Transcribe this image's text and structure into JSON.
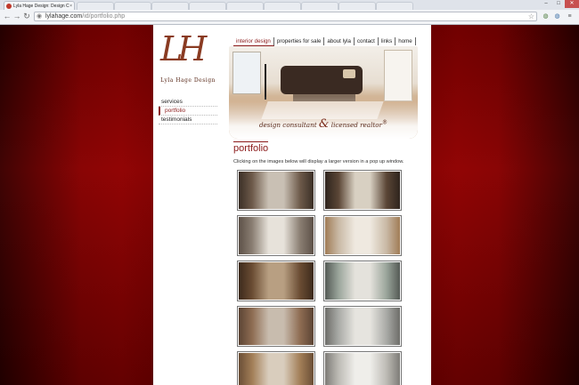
{
  "browser": {
    "tab_title": "Lyla Hage Design: Design C",
    "close_glyph": "×",
    "url_host": "lylahage.com",
    "url_path": "/id/portfolio.php",
    "nav_icons": [
      "back-arrow-icon",
      "forward-arrow-icon",
      "reload-icon"
    ],
    "window_controls": [
      "minimize-icon",
      "maximize-icon",
      "close-icon"
    ]
  },
  "site": {
    "logo_monogram": "LH",
    "logo_name": "Lyla Hage Design",
    "top_nav": [
      {
        "label": "interior design",
        "active": true
      },
      {
        "label": "properties for sale",
        "active": false
      },
      {
        "label": "about lyla",
        "active": false
      },
      {
        "label": "contact",
        "active": false
      },
      {
        "label": "links",
        "active": false
      },
      {
        "label": "home",
        "active": false
      }
    ],
    "side_nav": [
      {
        "label": "services",
        "active": false
      },
      {
        "label": "portfolio",
        "active": true
      },
      {
        "label": "testimonials",
        "active": false
      }
    ],
    "tagline_left": "design consultant",
    "tagline_amp": "&",
    "tagline_right": "licensed realtor",
    "tagline_mark": "®",
    "section_title": "portfolio",
    "intro_text": "Clicking on the images below will display a larger version in a pop up window.",
    "thumbnails": [
      {
        "name": "thumb-staircase-landing",
        "colors": [
          "#6d5a4a",
          "#c9c0b4",
          "#3b2f26"
        ]
      },
      {
        "name": "thumb-hallway-window",
        "colors": [
          "#5b4636",
          "#d8d0c2",
          "#2e241d"
        ]
      },
      {
        "name": "thumb-vaulted-living",
        "colors": [
          "#8a7e72",
          "#e7e2da",
          "#5d5148"
        ]
      },
      {
        "name": "thumb-white-railing",
        "colors": [
          "#c9b9a5",
          "#efe9e0",
          "#a07c56"
        ]
      },
      {
        "name": "thumb-arched-windows",
        "colors": [
          "#6a4c33",
          "#b89f82",
          "#3c2a1c"
        ]
      },
      {
        "name": "thumb-fireplace",
        "colors": [
          "#9aa59b",
          "#e4e2dc",
          "#545a55"
        ]
      },
      {
        "name": "thumb-living-room",
        "colors": [
          "#8e6c52",
          "#c8bcae",
          "#5b4434"
        ]
      },
      {
        "name": "thumb-kitchen-grey",
        "colors": [
          "#a9aaa6",
          "#e6e4df",
          "#6d6d69"
        ]
      },
      {
        "name": "thumb-kitchen-wood",
        "colors": [
          "#a27e57",
          "#d9cdbd",
          "#6a4e36"
        ]
      },
      {
        "name": "thumb-kitchen-white",
        "colors": [
          "#bdbbb5",
          "#efeeea",
          "#7e7c77"
        ]
      }
    ]
  },
  "colors": {
    "accent": "#8b1a1a",
    "background_red": "#850101"
  }
}
